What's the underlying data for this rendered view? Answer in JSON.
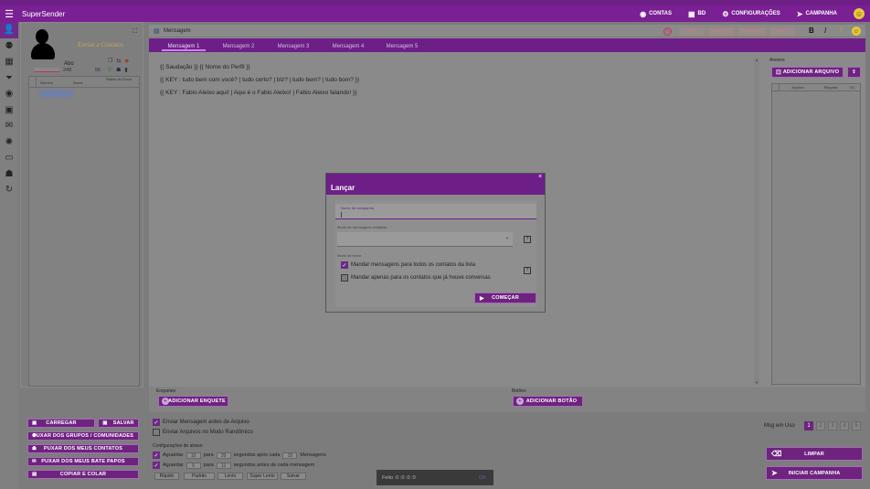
{
  "app": {
    "title": "SuperSender",
    "menu_icon": "hamburger-icon"
  },
  "topnav": [
    {
      "label": "CONTAS",
      "icon": "whatsapp-icon"
    },
    {
      "label": "BD",
      "icon": "database-icon"
    },
    {
      "label": "CONFIGURAÇÕES",
      "icon": "gear-icon"
    },
    {
      "label": "CAMPANHA",
      "icon": "send-icon"
    }
  ],
  "leftbar": [
    "user-icon",
    "group-icon",
    "calendar-icon",
    "filter-icon",
    "whatsapp-icon",
    "image-icon",
    "chat-icon",
    "settings-group-icon",
    "monitor-icon",
    "contact-icon",
    "refresh-icon"
  ],
  "contacts": {
    "enviar_label": "Enviar a Contatos",
    "expand_icon": "⛶",
    "status_label": "Abo",
    "count_a": "248",
    "count_b": "56",
    "col_numero": "Número",
    "col_nome": "Nome",
    "col_status": "Status do Envio",
    "buttons": {
      "carregar": "CARREGAR",
      "salvar": "SALVAR",
      "grupos": "PUXAR DOS GRUPOS / COMUNIDADES",
      "contatos": "PUXAR DOS MEUS CONTATOS",
      "bate_papos": "PUXAR DOS MEUS BATE PAPOS",
      "copiar": "COPIAR E COLAR"
    }
  },
  "editor": {
    "title": "Mensagem",
    "tabs": [
      "Mensagem 1",
      "Mensagem 2",
      "Mensagem 3",
      "Mensagem 4",
      "Mensagem 5"
    ],
    "format_buttons": [
      "Nome",
      "Saudação",
      "Rooftames",
      "Ipsilar"
    ],
    "style_buttons": [
      "B",
      "I",
      "T"
    ],
    "lines": [
      "{{ Saudação }} {{ Nome do Perfil }}",
      "{{ KEY : tudo bem com você? | tudo certo? | blz? | tudo bem? | tudo bom? }}",
      "{{ KEY : Fabio Aleixo aqui! | Aqui é o Fabio Aleixo! | Fabio Aleixo falando! }}"
    ]
  },
  "anexos": {
    "label": "Anexos",
    "add_button": "ADICIONAR ARQUIVO",
    "col_arquivo": "Arquivo",
    "col_etiqueta": "Etiqueta",
    "col_ec": "EC"
  },
  "enquetes": {
    "label": "Enquetes",
    "button": "ADICIONAR ENQUETE"
  },
  "botoes": {
    "label": "Botões",
    "button": "ADICIONAR BOTÃO"
  },
  "options": {
    "enviar_antes": "Enviar Mensagem antes de Arquivo",
    "arquivos_random": "Enviar Arquivos no Modo Randômico"
  },
  "msg_em_uso": {
    "label": "Msg em Uso",
    "pages": [
      "1",
      "2",
      "3",
      "4",
      "5"
    ]
  },
  "delay": {
    "title": "Configurações de atraso",
    "row1": {
      "aguardar": "Aguardar",
      "from": "10",
      "para": "para",
      "to": "20",
      "text": "segundos após cada",
      "count": "10",
      "unit": "Mensagens"
    },
    "row2": {
      "aguardar": "Aguardar",
      "from": "5",
      "para": "para",
      "to": "11",
      "text": "segundos antes de cada mensagem"
    },
    "presets": [
      "Rápido",
      "Padrão",
      "Lento",
      "Super Lento",
      "Salvar"
    ]
  },
  "actions": {
    "limpar": "LIMPAR",
    "iniciar": "INICIAR CAMPANHA"
  },
  "toast": {
    "text": "Feito :0 :0 :0 :0",
    "close": "OK"
  },
  "modal": {
    "title": "Lançar",
    "close": "×",
    "nome_label": "Nome da campanha",
    "modo_label": "Modo de mensagens múltiplas",
    "envio_label": "Modo de envio",
    "opt1": "Mandar mensagens para todos os contatos da lista",
    "opt2": "Mandar apenas para os contatos que já houve conversas",
    "help": "?",
    "start": "COMEÇAR"
  },
  "colors": {
    "purple": "#7a1f94",
    "gray": "#7e7e7e"
  }
}
